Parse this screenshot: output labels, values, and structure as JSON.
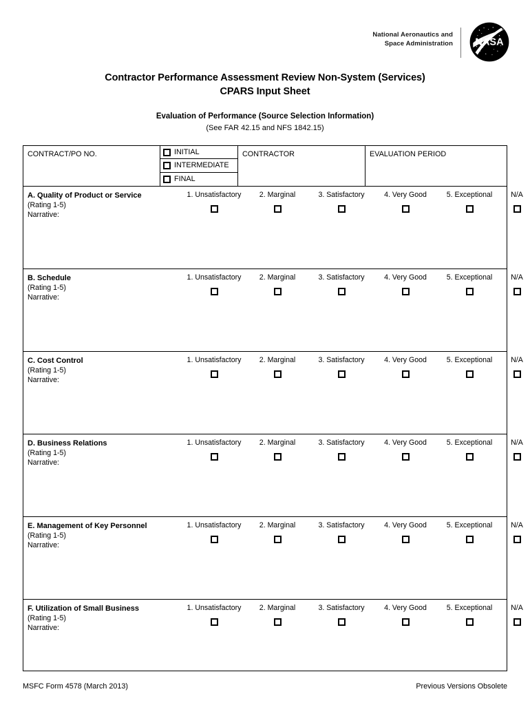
{
  "agency": {
    "wordmark_line1": "National Aeronautics and",
    "wordmark_line2": "Space Administration",
    "logo_icon": "nasa-meatball-logo",
    "logo_text": "NASA"
  },
  "title": {
    "line1": "Contractor Performance Assessment Review Non-System (Services)",
    "line2": "CPARS Input Sheet"
  },
  "subtitle": {
    "line1": "Evaluation of Performance (Source Selection Information)",
    "line2": "(See FAR 42.15 and NFS 1842.15)"
  },
  "header_row": {
    "contract_label": "CONTRACT/PO NO.",
    "contract_value": "",
    "type_options": [
      {
        "label": "INITIAL",
        "checked": false
      },
      {
        "label": "INTERMEDIATE",
        "checked": false
      },
      {
        "label": "FINAL",
        "checked": false
      }
    ],
    "contractor_label": "CONTRACTOR",
    "contractor_value": "",
    "evaluation_period_label": "EVALUATION PERIOD",
    "evaluation_period_value": ""
  },
  "rating_scale": [
    "1. Unsatisfactory",
    "2. Marginal",
    "3. Satisfactory",
    "4. Very Good",
    "5. Exceptional",
    "N/A"
  ],
  "criteria_common": {
    "rating_note": "(Rating 1-5)",
    "narrative_label": "Narrative:"
  },
  "criteria": [
    {
      "title": "A. Quality of Product or Service",
      "narrative_value": ""
    },
    {
      "title": "B. Schedule",
      "narrative_value": ""
    },
    {
      "title": "C. Cost Control",
      "narrative_value": ""
    },
    {
      "title": "D. Business Relations",
      "narrative_value": ""
    },
    {
      "title": "E. Management of Key Personnel",
      "narrative_value": ""
    },
    {
      "title": "F. Utilization of Small Business",
      "narrative_value": ""
    }
  ],
  "footer": {
    "form_id": "MSFC Form 4578 (March 2013)",
    "obsolete_note": "Previous Versions Obsolete"
  },
  "colors": {
    "ink": "#000000",
    "paper": "#ffffff",
    "rule": "#7a7a7a"
  }
}
